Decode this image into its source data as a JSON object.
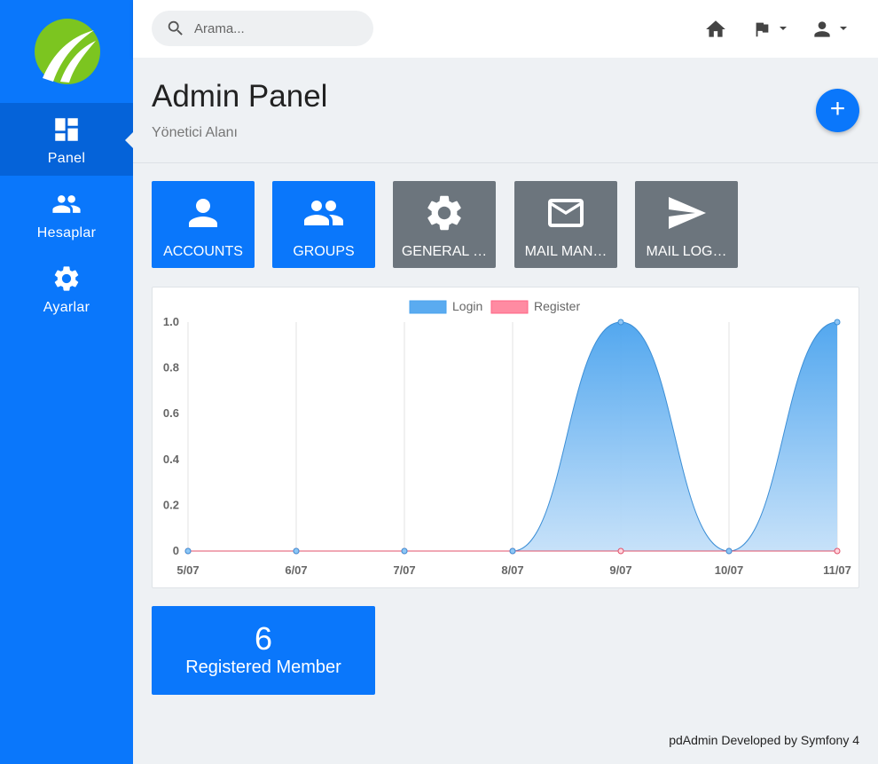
{
  "sidebar": {
    "items": [
      {
        "label": "Panel",
        "icon": "dashboard-icon",
        "active": true
      },
      {
        "label": "Hesaplar",
        "icon": "people-icon"
      },
      {
        "label": "Ayarlar",
        "icon": "gear-icon"
      }
    ]
  },
  "topbar": {
    "search_placeholder": "Arama...",
    "icons": [
      "search-icon",
      "home-icon",
      "flag-icon",
      "user-icon"
    ]
  },
  "header": {
    "title": "Admin Panel",
    "subtitle": "Yönetici Alanı",
    "fab_label": "+"
  },
  "tiles": [
    {
      "label": "ACCOUNTS",
      "icon": "person-icon",
      "color": "#0a77fb"
    },
    {
      "label": "GROUPS",
      "icon": "group-icon",
      "color": "#0a77fb"
    },
    {
      "label": "GENERAL …",
      "icon": "gear-icon",
      "color": "#6c757d"
    },
    {
      "label": "MAIL MAN…",
      "icon": "envelope-icon",
      "color": "#6c757d"
    },
    {
      "label": "MAIL LOG…",
      "icon": "send-icon",
      "color": "#6c757d"
    }
  ],
  "chart_data": {
    "type": "area",
    "x": [
      "5/07",
      "6/07",
      "7/07",
      "8/07",
      "9/07",
      "10/07",
      "11/07"
    ],
    "series": [
      {
        "name": "Login",
        "values": [
          0,
          0,
          0,
          0,
          1,
          0,
          1
        ],
        "color": "#5aabf0"
      },
      {
        "name": "Register",
        "values": [
          0,
          0,
          0,
          0,
          0,
          0,
          0
        ],
        "color": "#ff6384"
      }
    ],
    "ylim": [
      0,
      1
    ],
    "yticks": [
      "1.0",
      "0.8",
      "0.6",
      "0.4",
      "0.2",
      "0"
    ],
    "legend": "top-center",
    "grid": "vertical"
  },
  "stat": {
    "value": "6",
    "label": "Registered Member"
  },
  "footer": {
    "text": "pdAdmin Developed by Symfony 4"
  },
  "colors": {
    "primary": "#0a77fb",
    "tile_gray": "#6c757d",
    "logo_green": "#7cc520"
  }
}
